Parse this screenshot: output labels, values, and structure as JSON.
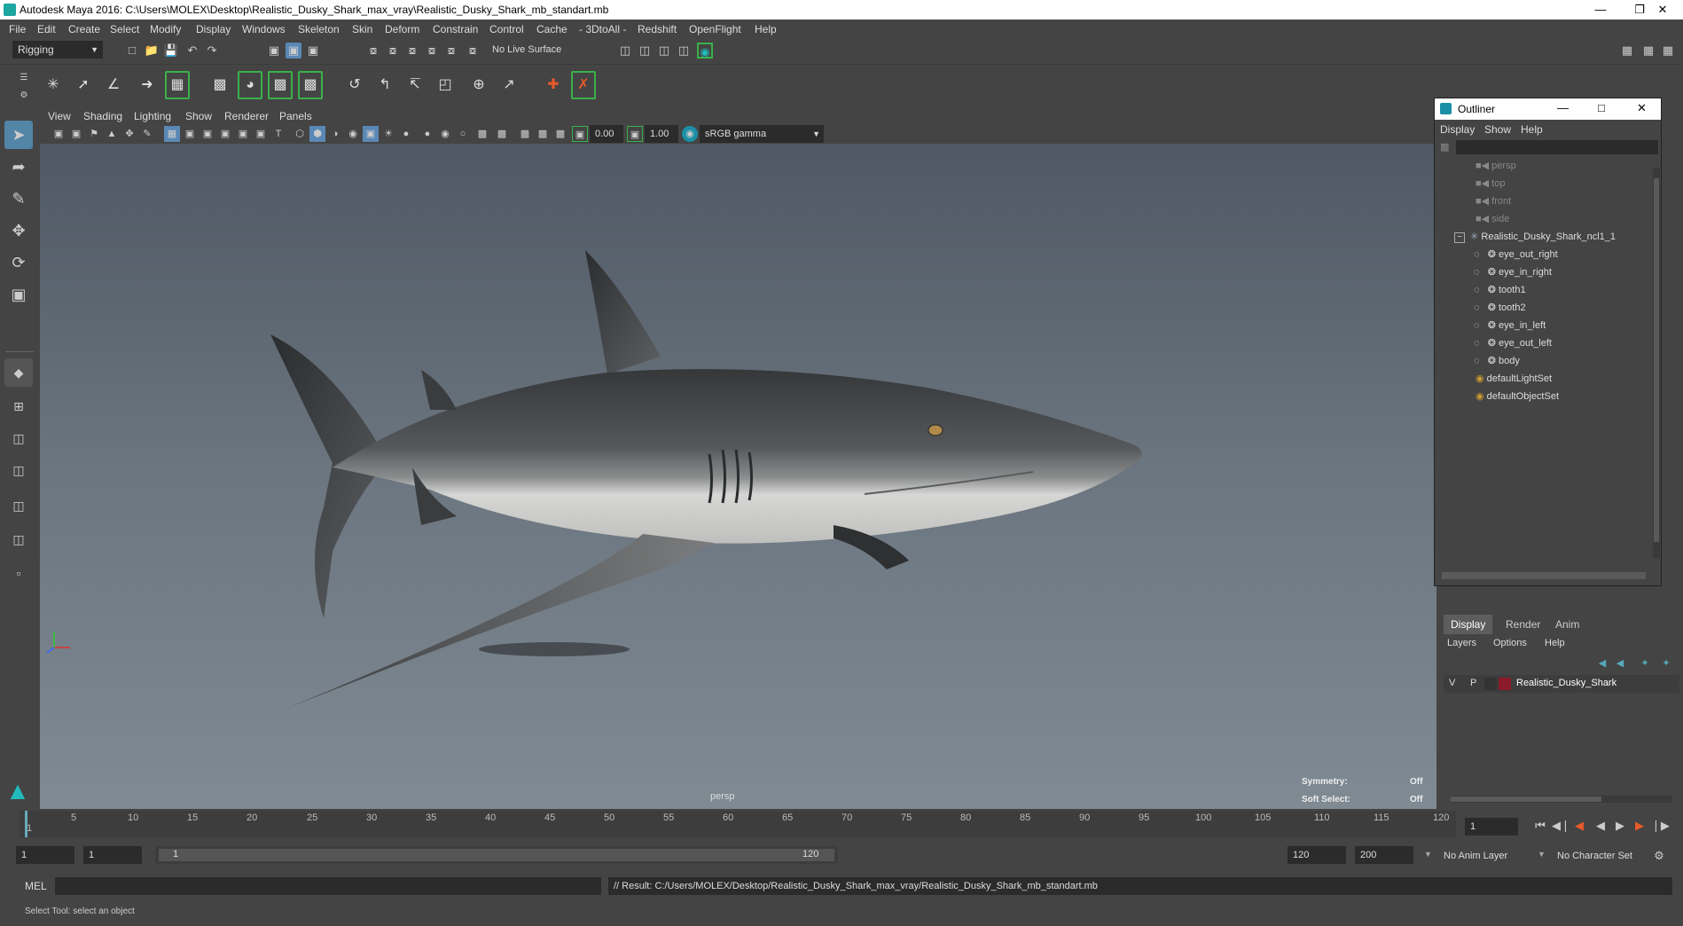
{
  "window": {
    "title": "Autodesk Maya 2016: C:\\Users\\MOLEX\\Desktop\\Realistic_Dusky_Shark_max_vray\\Realistic_Dusky_Shark_mb_standart.mb"
  },
  "menubar": [
    "File",
    "Edit",
    "Create",
    "Select",
    "Modify",
    "Display",
    "Windows",
    "Skeleton",
    "Skin",
    "Deform",
    "Constrain",
    "Control",
    "Cache",
    "- 3DtoAll -",
    "Redshift",
    "OpenFlight",
    "Help"
  ],
  "shelf": {
    "mode": "Rigging",
    "live_surface": "No Live Surface"
  },
  "viewport": {
    "menu": [
      "View",
      "Shading",
      "Lighting",
      "Show",
      "Renderer",
      "Panels"
    ],
    "exposure": "0.00",
    "gamma": "1.00",
    "color_space": "sRGB gamma",
    "camera_label": "persp",
    "symmetry_label": "Symmetry:",
    "symmetry_value": "Off",
    "soft_select_label": "Soft Select:",
    "soft_select_value": "Off"
  },
  "outliner": {
    "title": "Outliner",
    "menu": [
      "Display",
      "Show",
      "Help"
    ],
    "items": [
      {
        "label": "persp",
        "indent": 0,
        "dim": true
      },
      {
        "label": "top",
        "indent": 0,
        "dim": true
      },
      {
        "label": "front",
        "indent": 0,
        "dim": true
      },
      {
        "label": "side",
        "indent": 0,
        "dim": true
      },
      {
        "label": "Realistic_Dusky_Shark_ncl1_1",
        "indent": 0,
        "dim": false
      },
      {
        "label": "eye_out_right",
        "indent": 1,
        "dim": false
      },
      {
        "label": "eye_in_right",
        "indent": 1,
        "dim": false
      },
      {
        "label": "tooth1",
        "indent": 1,
        "dim": false
      },
      {
        "label": "tooth2",
        "indent": 1,
        "dim": false
      },
      {
        "label": "eye_in_left",
        "indent": 1,
        "dim": false
      },
      {
        "label": "eye_out_left",
        "indent": 1,
        "dim": false
      },
      {
        "label": "body",
        "indent": 1,
        "dim": false
      },
      {
        "label": "defaultLightSet",
        "indent": 0,
        "dim": false
      },
      {
        "label": "defaultObjectSet",
        "indent": 0,
        "dim": false
      }
    ]
  },
  "layers": {
    "tabs": [
      "Display",
      "Render",
      "Anim"
    ],
    "menu": [
      "Layers",
      "Options",
      "Help"
    ],
    "row": {
      "v": "V",
      "p": "P",
      "name": "Realistic_Dusky_Shark",
      "color": "#8b1a2a"
    }
  },
  "timeline": {
    "ticks": [
      "1",
      "5",
      "10",
      "15",
      "20",
      "25",
      "30",
      "35",
      "40",
      "45",
      "50",
      "55",
      "60",
      "65",
      "70",
      "75",
      "80",
      "85",
      "90",
      "95",
      "100",
      "105",
      "110",
      "115",
      "120"
    ],
    "current_frame": "1"
  },
  "range": {
    "start": "1",
    "playback_start": "1",
    "slider_start": "1",
    "slider_end": "120",
    "playback_end": "120",
    "end": "200",
    "anim_layer": "No Anim Layer",
    "char_set": "No Character Set"
  },
  "cmd": {
    "lang": "MEL",
    "result": "// Result: C:/Users/MOLEX/Desktop/Realistic_Dusky_Shark_max_vray/Realistic_Dusky_Shark_mb_standart.mb"
  },
  "help": {
    "text": "Select Tool: select an object"
  }
}
